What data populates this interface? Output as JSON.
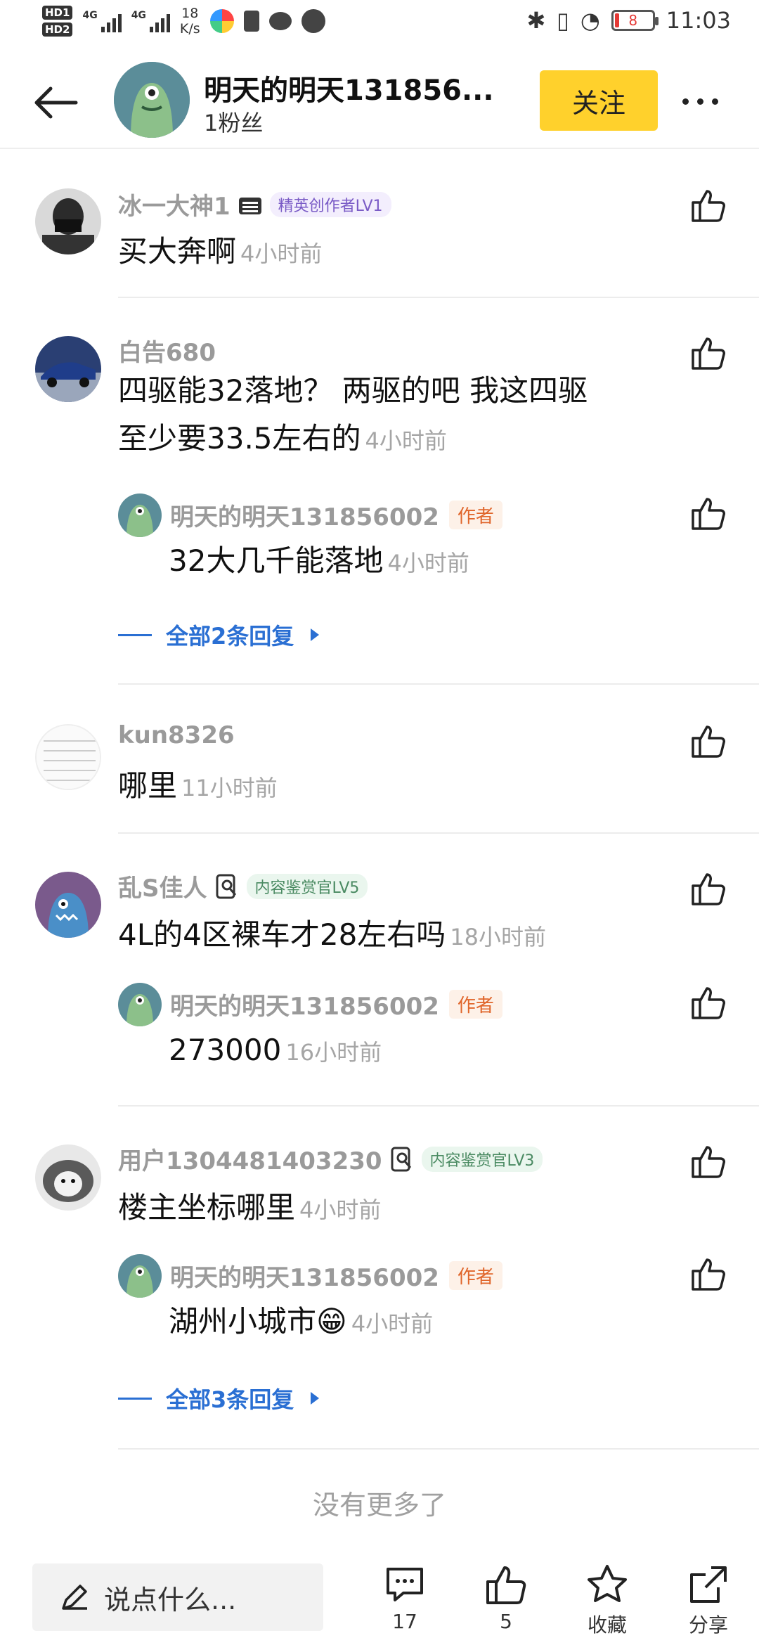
{
  "status_bar": {
    "hd1": "HD1",
    "hd2": "HD2",
    "net1": "4G",
    "net2": "4G",
    "speed_value": "18",
    "speed_unit": "K/s",
    "battery": "8",
    "time": "11:03"
  },
  "header": {
    "title": "明天的明天131856...",
    "fans": "1粉丝",
    "follow_label": "关注"
  },
  "comments": [
    {
      "user": "冰一大神1",
      "badge": "精英创作者LV1",
      "text": "买大奔啊",
      "time": "4小时前"
    },
    {
      "user": "白告680",
      "text_line1": "四驱能32落地？ 两驱的吧 我这四驱",
      "text_line2": "至少要33.5左右的",
      "time": "4小时前",
      "reply": {
        "user": "明天的明天131856002",
        "tag": "作者",
        "text": "32大几千能落地",
        "time": "4小时前"
      },
      "all_replies": "全部2条回复"
    },
    {
      "user": "kun8326",
      "text": "哪里",
      "time": "11小时前"
    },
    {
      "user": "乱S佳人",
      "badge": "内容鉴赏官LV5",
      "text": "4L的4区裸车才28左右吗",
      "time": "18小时前",
      "reply": {
        "user": "明天的明天131856002",
        "tag": "作者",
        "text": "273000",
        "time": "16小时前"
      }
    },
    {
      "user": "用户1304481403230",
      "badge": "内容鉴赏官LV3",
      "text": "楼主坐标哪里",
      "time": "4小时前",
      "reply": {
        "user": "明天的明天131856002",
        "tag": "作者",
        "text": "湖州小城市",
        "emoji": "😁",
        "time": "4小时前"
      },
      "all_replies": "全部3条回复"
    }
  ],
  "no_more": "没有更多了",
  "bottom_bar": {
    "input_placeholder": "说点什么...",
    "comment_count": "17",
    "like_count": "5",
    "favorite_label": "收藏",
    "share_label": "分享"
  }
}
